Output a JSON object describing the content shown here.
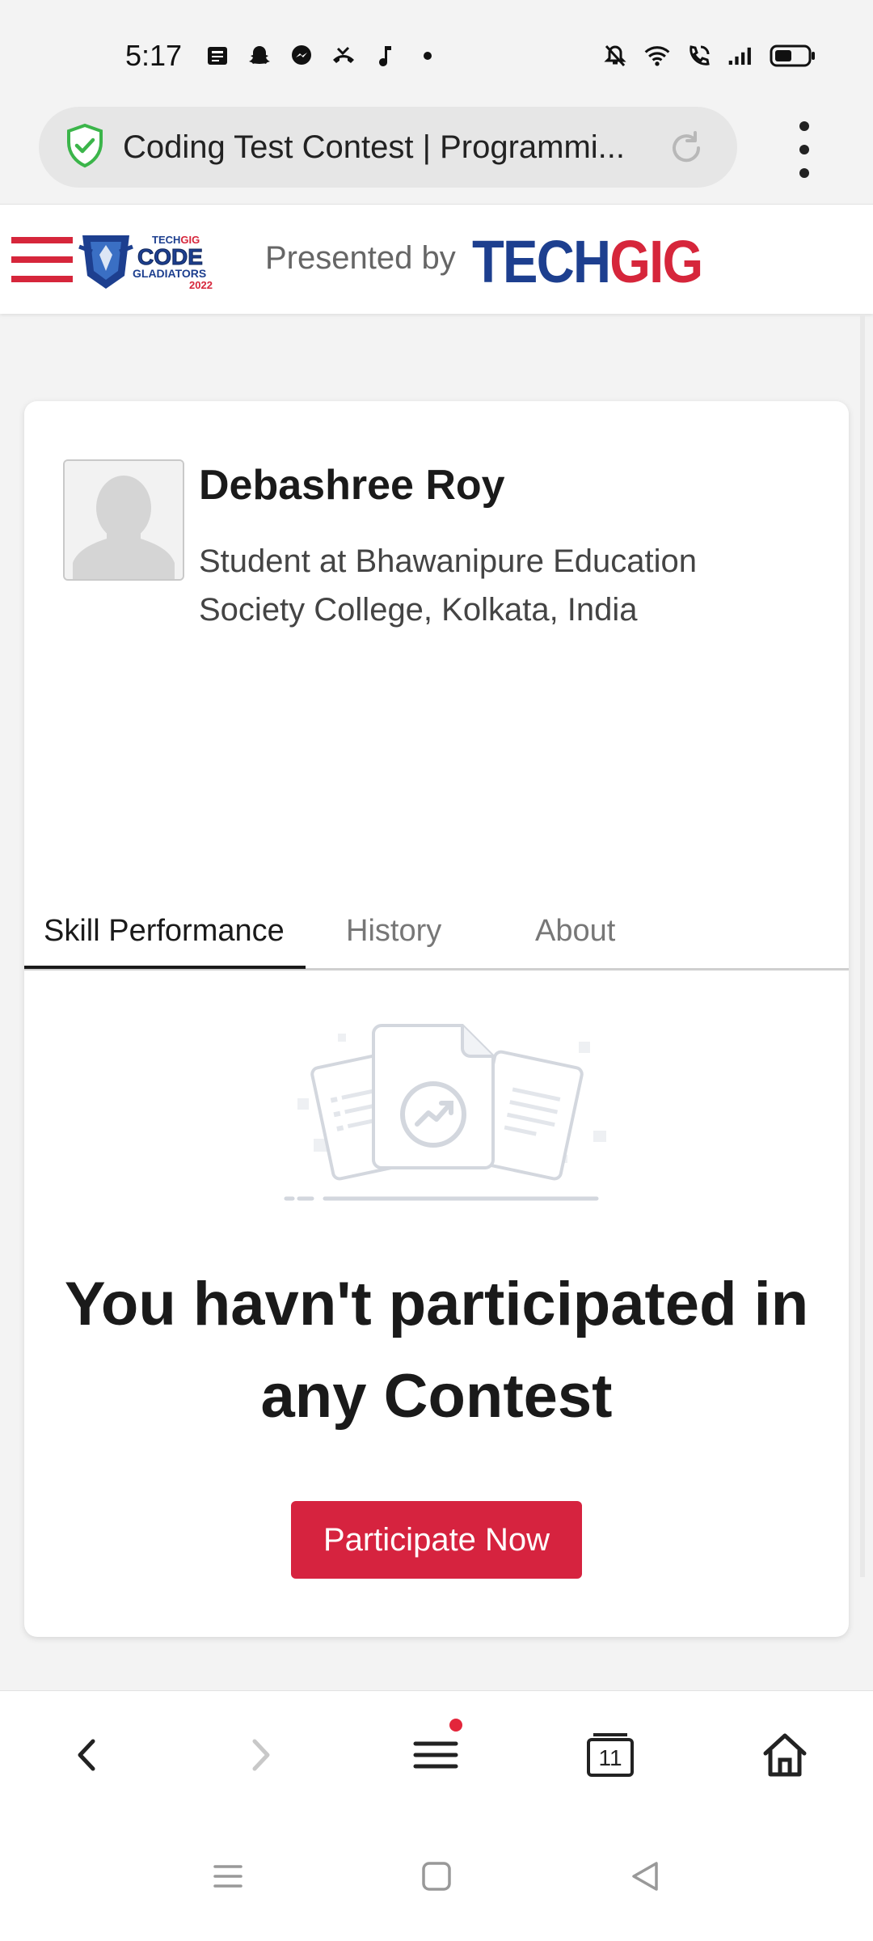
{
  "status_bar": {
    "time": "5:17",
    "left_icons": [
      "news-icon",
      "snapchat-icon",
      "messenger-icon",
      "missed-call-icon",
      "music-note-icon",
      "dot-icon"
    ],
    "right_icons": [
      "mute-icon",
      "wifi-icon",
      "wifi-calling-icon",
      "signal-icon",
      "battery-icon"
    ]
  },
  "browser": {
    "url_title": "Coding Test Contest | Programmi...",
    "security_icon": "shield-check-icon",
    "reload_icon": "reload-icon",
    "menu_icon": "more-vertical-icon"
  },
  "site_header": {
    "presented_by": "Presented by",
    "brand_part1": "TECH",
    "brand_part2": "GIG",
    "logo_top": "TECHGIG",
    "logo_main": "CODE",
    "logo_sub": "GLADIATORS",
    "logo_year": "2022",
    "colors": {
      "brand_red": "#d6263b",
      "brand_blue": "#1d3f8f"
    }
  },
  "profile": {
    "name": "Debashree Roy",
    "subtitle": "Student at Bhawanipure Education Society College, Kolkata, India"
  },
  "tabs": [
    {
      "label": "Skill Performance",
      "active": true
    },
    {
      "label": "History",
      "active": false
    },
    {
      "label": "About",
      "active": false
    }
  ],
  "empty_state": {
    "message": "You havn't participated in any Contest",
    "button_label": "Participate Now",
    "button_color": "#d6233f"
  },
  "bottom_bar": {
    "items": [
      "back-icon",
      "forward-icon",
      "menu-icon",
      "tabs-icon",
      "home-icon"
    ],
    "tab_count": "11"
  },
  "system_nav": {
    "items": [
      "recent-apps-icon",
      "home-square-icon",
      "back-triangle-icon"
    ]
  }
}
